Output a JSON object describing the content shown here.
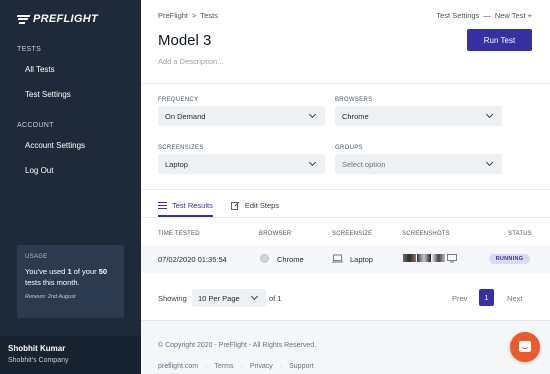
{
  "brand": {
    "name": "PREFLIGHT"
  },
  "sidebar": {
    "sections": [
      {
        "title": "TESTS",
        "items": [
          {
            "label": "All Tests"
          },
          {
            "label": "Test Settings"
          }
        ]
      },
      {
        "title": "ACCOUNT",
        "items": [
          {
            "label": "Account Settings"
          },
          {
            "label": "Log Out"
          }
        ]
      }
    ],
    "usage": {
      "title": "USAGE",
      "text_prefix": "You've used ",
      "used": "1",
      "text_middle": " of your ",
      "limit": "50",
      "text_suffix": " tests this month.",
      "renews": "Renews: 2nd August"
    },
    "user": {
      "name": "Shobhit Kumar",
      "company": "Shobhit's Company"
    }
  },
  "header": {
    "breadcrumb": {
      "root": "PreFlight",
      "separator": ">",
      "current": "Tests"
    },
    "links": {
      "settings": "Test Settings",
      "separator": "—",
      "new_test": "New Test +"
    },
    "title": "Model 3",
    "description_placeholder": "Add a Description...",
    "run_button": "Run Test"
  },
  "form": {
    "frequency": {
      "label": "FREQUENCY",
      "value": "On Demand"
    },
    "browsers": {
      "label": "BROWSERS",
      "value": "Chrome"
    },
    "screensizes": {
      "label": "SCREENSIZES",
      "value": "Laptop"
    },
    "groups": {
      "label": "GROUPS",
      "value": "Select option"
    }
  },
  "tabs": [
    {
      "label": "Test Results",
      "icon": "list-icon",
      "active": true
    },
    {
      "label": "Edit Steps",
      "icon": "edit-icon",
      "active": false
    }
  ],
  "table": {
    "headers": {
      "time": "TIME TESTED",
      "browser": "BROWSER",
      "screensize": "SCREENSIZE",
      "screenshots": "SCREENSHOTS",
      "status": "STATUS"
    },
    "rows": [
      {
        "time": "07/02/2020 01:35:54",
        "browser": "Chrome",
        "screensize": "Laptop",
        "status": "RUNNING"
      }
    ]
  },
  "pagination": {
    "showing": "Showing",
    "per_page": "10 Per Page",
    "of_pages": "of 1",
    "prev": "Prev",
    "current": "1",
    "next": "Next"
  },
  "footer": {
    "copyright": "© Copyright 2020 - PreFlight - All Rights Reserved.",
    "links": [
      "preflight.com",
      "Terms",
      "Privacy",
      "Support"
    ],
    "separator": "·"
  },
  "colors": {
    "sidebar": "#1e2a3a",
    "accent": "#3730a3",
    "chat": "#ea5a2a"
  }
}
